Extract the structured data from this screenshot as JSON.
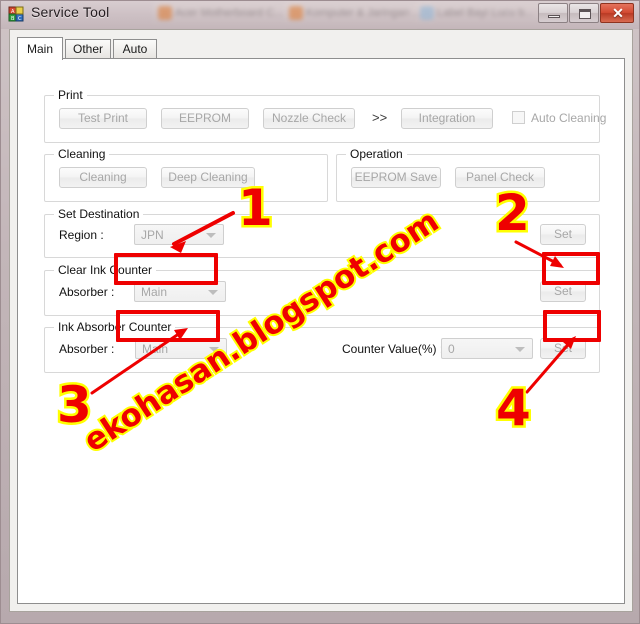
{
  "window": {
    "title": "Service Tool",
    "app_icon": "blocks-icon",
    "controls": {
      "minimize": "minimize-icon",
      "maximize": "maximize-icon",
      "close": "✕"
    },
    "background_tabs": [
      "Acer Motherboard C...",
      "Komputer & Jaringan ...",
      "Label Bayi Lucu b..."
    ]
  },
  "tabs": [
    {
      "label": "Main",
      "active": true
    },
    {
      "label": "Other",
      "active": false
    },
    {
      "label": "Auto",
      "active": false
    }
  ],
  "groups": {
    "print": {
      "title": "Print",
      "buttons": [
        "Test Print",
        "EEPROM",
        "Nozzle Check",
        "Integration"
      ],
      "chevron": ">>",
      "checkbox": {
        "label": "Auto Cleaning",
        "checked": false
      }
    },
    "cleaning": {
      "title": "Cleaning",
      "buttons": [
        "Cleaning",
        "Deep Cleaning"
      ]
    },
    "operation": {
      "title": "Operation",
      "buttons": [
        "EEPROM Save",
        "Panel Check"
      ]
    },
    "set_destination": {
      "title": "Set Destination",
      "region_label": "Region :",
      "region_value": "JPN",
      "set_label": "Set"
    },
    "clear_ink_counter": {
      "title": "Clear Ink Counter",
      "absorber_label": "Absorber :",
      "absorber_value": "Main",
      "set_label": "Set"
    },
    "ink_absorber_counter": {
      "title": "Ink Absorber Counter",
      "absorber_label": "Absorber :",
      "absorber_value": "Main",
      "counter_label": "Counter Value(%) :",
      "counter_value": "0",
      "set_label": "Set"
    }
  },
  "annotations": {
    "numbers": [
      "1",
      "2",
      "3",
      "4"
    ],
    "watermark": "ekohasan.blogspot.com",
    "fill_color": "#ee0000",
    "outline_color": "#ffff00"
  }
}
